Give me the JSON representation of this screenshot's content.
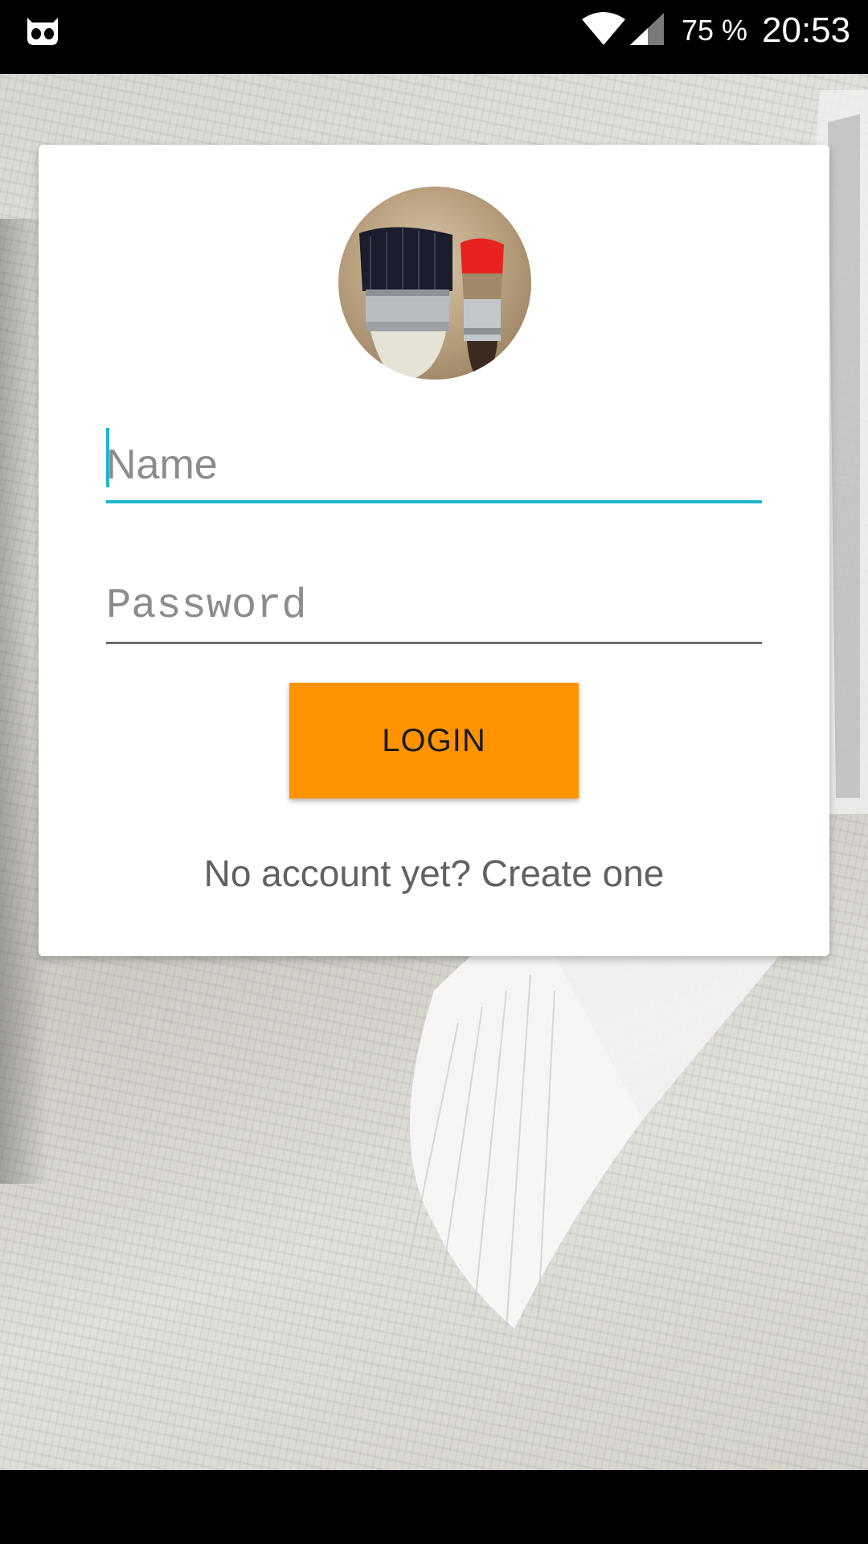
{
  "status_bar": {
    "battery": "75 %",
    "time": "20:53",
    "left_icon": "cyanogen-mascot-icon",
    "wifi_icon": "wifi-icon",
    "signal_icon": "cell-signal-icon"
  },
  "login_card": {
    "avatar": "paint-brushes-avatar",
    "name_field": {
      "placeholder": "Name",
      "value": ""
    },
    "password_field": {
      "placeholder": "Password",
      "value": ""
    },
    "login_button_label": "LOGIN",
    "create_account_text": "No account yet? Create one"
  },
  "colors": {
    "accent": "#1cb7cf",
    "button": "#ff9400",
    "card": "#ffffff",
    "status_bar": "#000000"
  }
}
